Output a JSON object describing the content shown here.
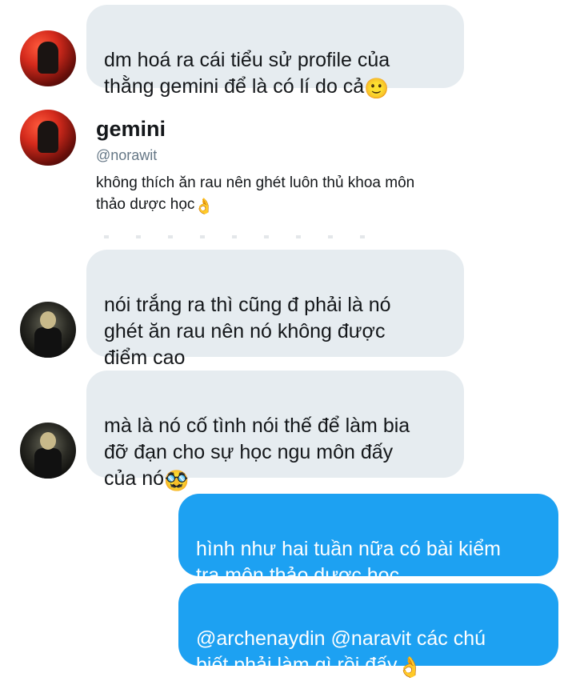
{
  "messages": [
    {
      "text": "dm hoá ra cái tiểu sử profile của\nthằng gemini để là có lí do cả",
      "emoji": "🙂",
      "direction": "incoming",
      "avatar": "red"
    },
    {
      "text": "nói trắng ra thì cũng đ phải là nó\nghét ăn rau nên nó không được\nđiểm cao",
      "emoji": "",
      "direction": "incoming",
      "avatar": "dark"
    },
    {
      "text": "mà là nó cố tình nói thế để làm bia\nđỡ đạn cho sự học ngu môn đấy\ncủa nó",
      "emoji": "🥸",
      "direction": "incoming",
      "avatar": "dark"
    },
    {
      "text": "hình như hai tuần nữa có bài kiểm\ntra môn thảo dược học",
      "emoji": "",
      "direction": "outgoing"
    },
    {
      "text": "@archenaydin @naravit các chú\nbiết phải làm gì rồi đấy",
      "emoji": "👌",
      "direction": "outgoing"
    }
  ],
  "profile_card": {
    "name": "gemini",
    "handle": "@norawit",
    "bio": "không thích ăn rau nên ghét luôn thủ khoa môn\nthảo dược học",
    "bio_emoji": "👌"
  },
  "colors": {
    "incoming_bubble": "#e6ecf0",
    "outgoing_bubble": "#1da1f2",
    "handle": "#657786"
  }
}
